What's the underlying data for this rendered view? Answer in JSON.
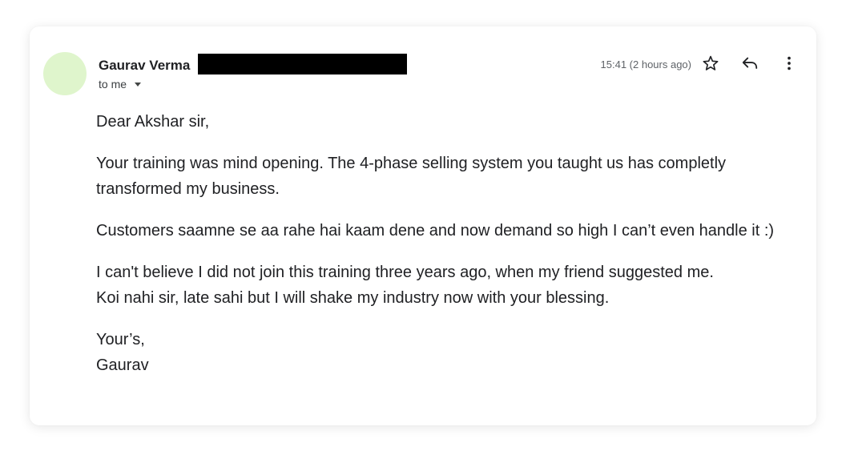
{
  "colors": {
    "avatar_bg": "#dff5cc",
    "text_primary": "#202124",
    "text_secondary": "#5f6368",
    "redaction": "#000000"
  },
  "header": {
    "sender_name": "Gaurav Verma",
    "recipient_label": "to me",
    "timestamp": "15:41 (2 hours ago)",
    "icons": {
      "star": "star-icon",
      "reply": "reply-icon",
      "more": "more-vert-icon",
      "caret": "chevron-down-icon"
    }
  },
  "message": {
    "greeting": "Dear Akshar sir,",
    "para1": "Your training was mind opening. The 4-phase selling system you taught us has completly transformed my business.",
    "para1_line1": "Your training was mind opening. The 4-phase selling system you taught us has completly",
    "para1_line2": "transformed my business.",
    "para2": "Customers saamne se aa rahe hai kaam dene and now demand so high I can’t even handle it :)",
    "para3_line1": "I can't believe I did not join this training three years ago, when my friend suggested me.",
    "para3_line2": "Koi nahi sir, late sahi but I will shake my industry now with your blessing.",
    "closing": "Your’s,",
    "signature": "Gaurav"
  }
}
